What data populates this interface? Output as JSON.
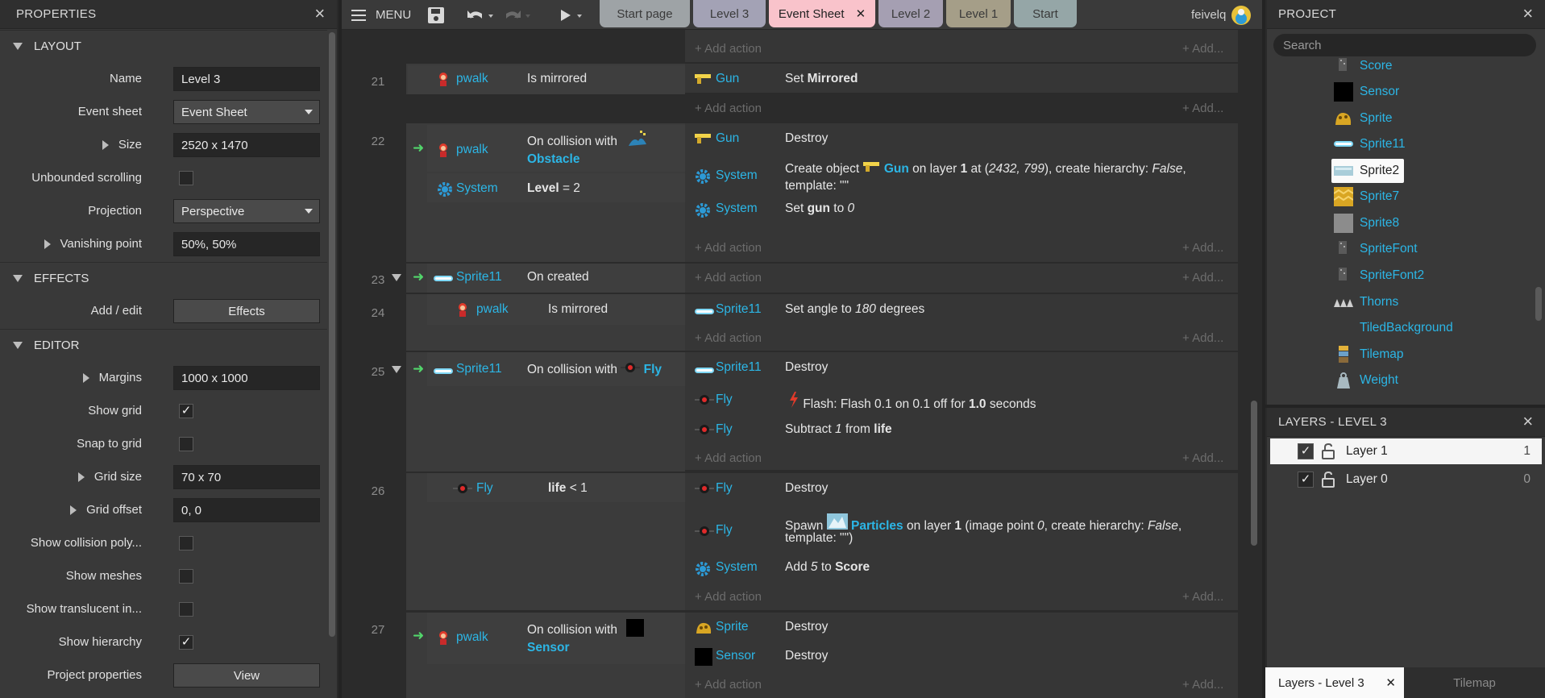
{
  "properties": {
    "title": "PROPERTIES",
    "sections": {
      "layout": "LAYOUT",
      "effects": "EFFECTS",
      "editor": "EDITOR"
    },
    "layout_props": {
      "name_label": "Name",
      "name_value": "Level 3",
      "eventsheet_label": "Event sheet",
      "eventsheet_value": "Event Sheet",
      "size_label": "Size",
      "size_value": "2520 x 1470",
      "unbounded_label": "Unbounded scrolling",
      "projection_label": "Projection",
      "projection_value": "Perspective",
      "vanishing_label": "Vanishing point",
      "vanishing_value": "50%, 50%"
    },
    "effects_props": {
      "addedit_label": "Add / edit",
      "effects_button": "Effects"
    },
    "editor_props": {
      "margins_label": "Margins",
      "margins_value": "1000 x 1000",
      "showgrid_label": "Show grid",
      "snap_label": "Snap to grid",
      "gridsize_label": "Grid size",
      "gridsize_value": "70 x 70",
      "gridoffset_label": "Grid offset",
      "gridoffset_value": "0, 0",
      "collision_label": "Show collision poly...",
      "meshes_label": "Show meshes",
      "translucent_label": "Show translucent in...",
      "hierarchy_label": "Show hierarchy",
      "projprops_label": "Project properties",
      "view_button": "View"
    },
    "checks": {
      "showgrid": "✓",
      "hierarchy": "✓"
    }
  },
  "topbar": {
    "menu_label": "MENU",
    "user": "feivelq",
    "tabs": [
      {
        "label": "Start page"
      },
      {
        "label": "Level 3"
      },
      {
        "label": "Event Sheet",
        "close": "✕"
      },
      {
        "label": "Level 2"
      },
      {
        "label": "Level 1"
      },
      {
        "label": "Start"
      }
    ]
  },
  "sheet": {
    "add_action": "Add action",
    "add_more": "Add...",
    "line_numbers": [
      "21",
      "22",
      "23",
      "24",
      "25",
      "26",
      "27"
    ],
    "ev21": {
      "obj": "pwalk",
      "cond": "Is mirrored",
      "act_obj": "Gun",
      "act_pre": "Set ",
      "act_bold": "Mirrored"
    },
    "ev22": {
      "obj1": "pwalk",
      "cond1_pre": "On collision with",
      "cond1_obj": "Obstacle",
      "obj2": "System",
      "cond2_bold": "Level",
      "cond2_rest": " = 2",
      "a1_obj": "Gun",
      "a1": "Destroy",
      "a2_obj": "System",
      "a2_pre": "Create object",
      "a2_gun": "Gun",
      "a2_mid": " on layer ",
      "a2_layer": "1",
      "a2_at": " at (",
      "a2_coords": "2432, 799",
      "a2_rest": "), create hierarchy: ",
      "a2_false": "False",
      "a2_comma": ",",
      "a2_tpl": "template: \"\"",
      "a3_obj": "System",
      "a3_pre": "Set ",
      "a3_bold": "gun",
      "a3_to": " to ",
      "a3_val": "0"
    },
    "ev23": {
      "obj": "Sprite11",
      "cond": "On created"
    },
    "ev24": {
      "obj": "pwalk",
      "cond": "Is mirrored",
      "act_obj": "Sprite11",
      "act_pre": "Set angle to ",
      "act_val": "180",
      "act_post": " degrees"
    },
    "ev25": {
      "obj": "Sprite11",
      "cond_pre": "On collision with",
      "cond_obj": "Fly",
      "a1_obj": "Sprite11",
      "a1": "Destroy",
      "a2_obj": "Fly",
      "a2_pre": "Flash: Flash 0.1 on 0.1 off for ",
      "a2_bold": "1.0",
      "a2_post": " seconds",
      "a3_obj": "Fly",
      "a3_pre": "Subtract ",
      "a3_val": "1",
      "a3_from": " from ",
      "a3_bold": "life"
    },
    "ev26": {
      "obj": "Fly",
      "cond_bold": "life",
      "cond_rest": " < 1",
      "a1_obj": "Fly",
      "a1": "Destroy",
      "a2_obj": "Fly",
      "a2_pre": "Spawn ",
      "a2_part": "Particles",
      "a2_mid": " on layer ",
      "a2_layer": "1",
      "a2_ip": " (image point ",
      "a2_zero": "0",
      "a2_rest": ", create hierarchy: ",
      "a2_false": "False",
      "a2_comma": ",",
      "a2_tpl": "template: \"\")",
      "a3_obj": "System",
      "a3_pre": "Add ",
      "a3_val": "5",
      "a3_to": " to ",
      "a3_bold": "Score"
    },
    "ev27": {
      "obj": "pwalk",
      "cond_pre": "On collision with",
      "cond_obj": "Sensor",
      "a1_obj": "Sprite",
      "a1": "Destroy",
      "a2_obj": "Sensor",
      "a2": "Destroy"
    }
  },
  "project": {
    "title": "PROJECT",
    "search_placeholder": "Search",
    "items": [
      "Score",
      "Sensor",
      "Sprite",
      "Sprite11",
      "Sprite2",
      "Sprite7",
      "Sprite8",
      "SpriteFont",
      "SpriteFont2",
      "Thorns",
      "TiledBackground",
      "Tilemap",
      "Weight"
    ]
  },
  "layers": {
    "title": "LAYERS - LEVEL 3",
    "items": [
      {
        "name": "Layer 1",
        "index": "1",
        "check": "✓"
      },
      {
        "name": "Layer 0",
        "index": "0",
        "check": "✓"
      }
    ]
  },
  "bottom_tabs": {
    "active": "Layers - Level 3",
    "close": "✕",
    "other": "Tilemap"
  },
  "colors": {
    "accent": "#2cb6e6",
    "trigger_arrow": "#52d66b",
    "active_tab": "#f9c3cb"
  }
}
